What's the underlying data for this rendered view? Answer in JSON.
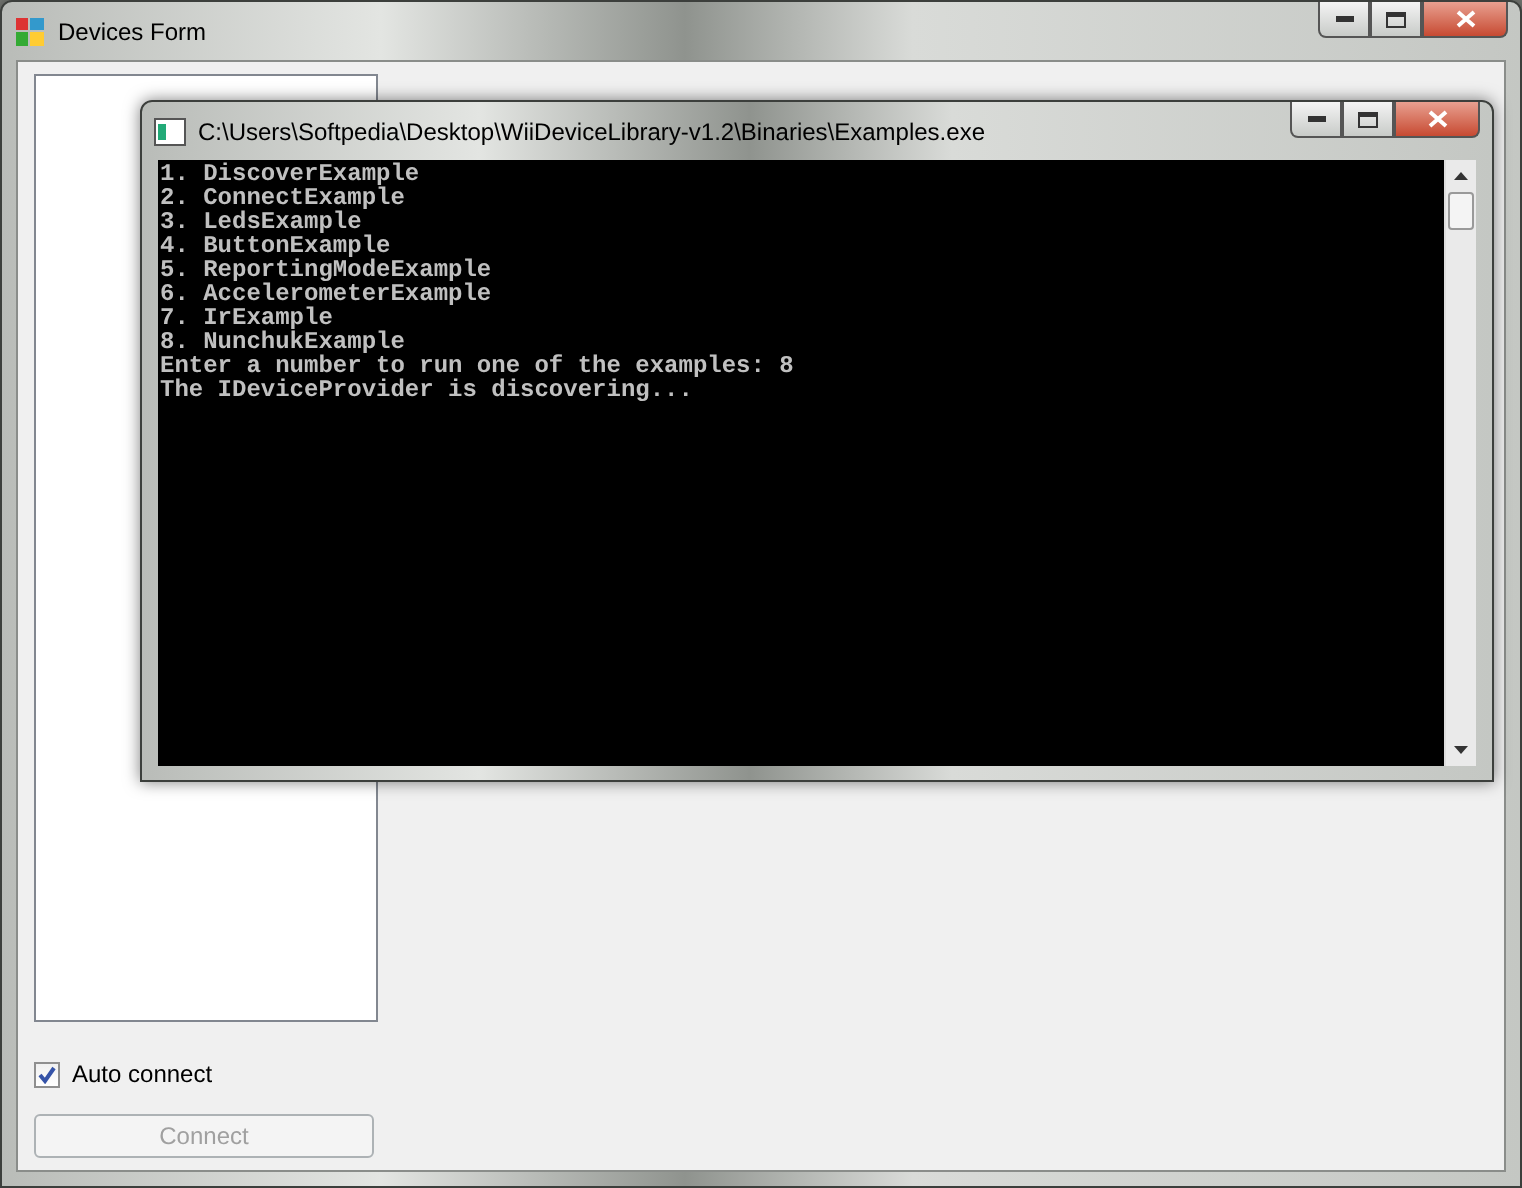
{
  "main_window": {
    "title": "Devices Form",
    "auto_connect": {
      "label": "Auto connect",
      "checked": true
    },
    "connect_button": {
      "label": "Connect",
      "disabled": true
    }
  },
  "console_window": {
    "title": "C:\\Users\\Softpedia\\Desktop\\WiiDeviceLibrary-v1.2\\Binaries\\Examples.exe",
    "lines": [
      "1. DiscoverExample",
      "2. ConnectExample",
      "3. LedsExample",
      "4. ButtonExample",
      "5. ReportingModeExample",
      "6. AccelerometerExample",
      "7. IrExample",
      "8. NunchukExample",
      "Enter a number to run one of the examples: 8",
      "The IDeviceProvider is discovering..."
    ]
  }
}
